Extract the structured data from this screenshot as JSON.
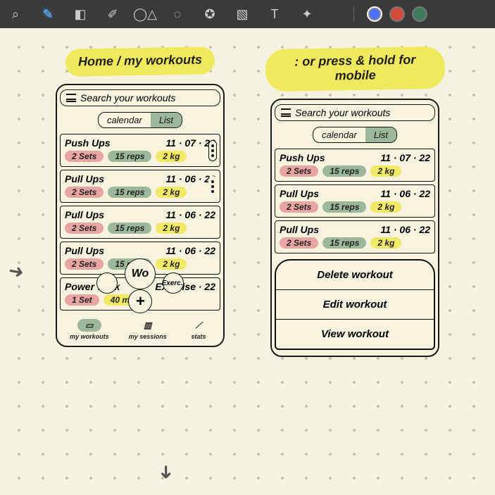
{
  "toolbar": {
    "tools": [
      {
        "name": "zoom",
        "glyph": "⌕"
      },
      {
        "name": "pen",
        "glyph": "✎",
        "active": true
      },
      {
        "name": "eraser",
        "glyph": "◧"
      },
      {
        "name": "highlighter",
        "glyph": "✐"
      },
      {
        "name": "shapes",
        "glyph": "◯△"
      },
      {
        "name": "lasso",
        "glyph": "◌"
      },
      {
        "name": "stamp",
        "glyph": "✪"
      },
      {
        "name": "image",
        "glyph": "▧"
      },
      {
        "name": "text",
        "glyph": "T"
      },
      {
        "name": "wand",
        "glyph": "✦"
      }
    ],
    "colors": [
      {
        "name": "blue",
        "hex": "#4a6fff",
        "selected": true
      },
      {
        "name": "red",
        "hex": "#d44b3a"
      },
      {
        "name": "green",
        "hex": "#3f7a5a"
      }
    ]
  },
  "leftTitle": "Home / my workouts",
  "rightTitle": ": or press & hold for mobile",
  "searchPlaceholder": "Search your workouts",
  "segCalendar": "calendar",
  "segList": "List",
  "leftWorkouts": [
    {
      "title": "Push Ups",
      "date": "11 · 07 · 22",
      "sets": "2 Sets",
      "reps": "15 reps",
      "kg": "2 kg",
      "kebab": "boxed"
    },
    {
      "title": "Pull Ups",
      "date": "11 · 06 · 22",
      "sets": "2 Sets",
      "reps": "15 reps",
      "kg": "2 kg",
      "kebab": "dots"
    },
    {
      "title": "Pull Ups",
      "date": "11 · 06 · 22",
      "sets": "2 Sets",
      "reps": "15 reps",
      "kg": "2 kg",
      "kebab": "none"
    },
    {
      "title": "Pull Ups",
      "date": "11 · 06 · 22",
      "sets": "2 Sets",
      "reps": "15 reps",
      "kg": "2 kg",
      "kebab": "none"
    },
    {
      "title": "Power Walk",
      "date": "Exercise · 22",
      "sets": "1 Set",
      "reps": "",
      "kg": "40 mins",
      "kebab": "none"
    }
  ],
  "fab": {
    "main": "Wo",
    "left": "",
    "right": "Exerc..",
    "plus": "+"
  },
  "nav": [
    {
      "label": "my workouts",
      "glyph": "▭",
      "selected": true
    },
    {
      "label": "my sessions",
      "glyph": "▥",
      "selected": false
    },
    {
      "label": "stats",
      "glyph": "⟋",
      "selected": false
    }
  ],
  "rightWorkouts": [
    {
      "title": "Push Ups",
      "date": "11 · 07 · 22",
      "sets": "2 Sets",
      "reps": "15 reps",
      "kg": "2 kg"
    },
    {
      "title": "Pull Ups",
      "date": "11 · 06 · 22",
      "sets": "2 Sets",
      "reps": "15 reps",
      "kg": "2 kg"
    },
    {
      "title": "Pull Ups",
      "date": "11 · 06 · 22",
      "sets": "2 Sets",
      "reps": "15 reps",
      "kg": "2 kg"
    }
  ],
  "contextMenu": [
    "Delete workout",
    "Edit workout",
    "View workout"
  ]
}
